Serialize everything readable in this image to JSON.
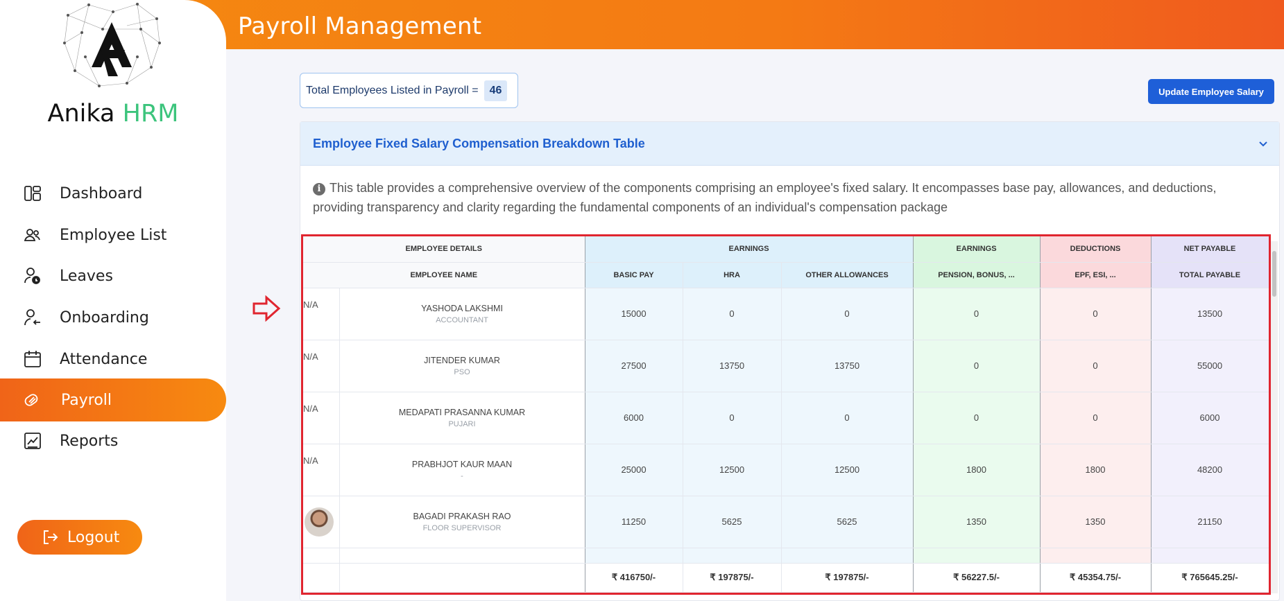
{
  "header": {
    "title": "Payroll Management"
  },
  "brand": {
    "name": "Anika",
    "suffix": "HRM"
  },
  "sidebar": {
    "items": [
      {
        "label": "Dashboard",
        "icon": "dashboard-icon",
        "active": false
      },
      {
        "label": "Employee List",
        "icon": "users-icon",
        "active": false
      },
      {
        "label": "Leaves",
        "icon": "user-clock-icon",
        "active": false
      },
      {
        "label": "Onboarding",
        "icon": "user-arrow-icon",
        "active": false
      },
      {
        "label": "Attendance",
        "icon": "calendar-icon",
        "active": false
      },
      {
        "label": "Payroll",
        "icon": "payroll-icon",
        "active": true
      },
      {
        "label": "Reports",
        "icon": "report-chart-icon",
        "active": false
      }
    ],
    "logout_label": "Logout"
  },
  "summary": {
    "label": "Total Employees Listed in Payroll =",
    "count": "46"
  },
  "actions": {
    "update_salary_label": "Update Employee Salary"
  },
  "accordion": {
    "title": "Employee Fixed Salary Compensation Breakdown Table",
    "description": "This table provides a comprehensive overview of the components comprising an employee's fixed salary. It encompasses base pay, allowances, and deductions, providing transparency and clarity regarding the fundamental components of an individual's compensation package"
  },
  "table": {
    "group_headers": [
      "EMPLOYEE DETAILS",
      "EARNINGS",
      "EARNINGS",
      "DEDUCTIONS",
      "NET PAYABLE"
    ],
    "column_headers": [
      "EMPLOYEE NAME",
      "BASIC PAY",
      "HRA",
      "OTHER ALLOWANCES",
      "PENSION, BONUS, ...",
      "EPF, ESI, ...",
      "TOTAL PAYABLE"
    ],
    "rows": [
      {
        "photo": "N/A",
        "name": "YASHODA LAKSHMI",
        "role": "ACCOUNTANT",
        "basic": "15000",
        "hra": "0",
        "other": "0",
        "pension": "0",
        "epf": "0",
        "total": "13500"
      },
      {
        "photo": "N/A",
        "name": "JITENDER KUMAR",
        "role": "PSO",
        "basic": "27500",
        "hra": "13750",
        "other": "13750",
        "pension": "0",
        "epf": "0",
        "total": "55000"
      },
      {
        "photo": "N/A",
        "name": "MEDAPATI PRASANNA KUMAR",
        "role": "PUJARI",
        "basic": "6000",
        "hra": "0",
        "other": "0",
        "pension": "0",
        "epf": "0",
        "total": "6000"
      },
      {
        "photo": "N/A",
        "name": "PRABHJOT KAUR MAAN",
        "role": "-",
        "basic": "25000",
        "hra": "12500",
        "other": "12500",
        "pension": "1800",
        "epf": "1800",
        "total": "48200"
      },
      {
        "photo": "avatar",
        "name": "BAGADI PRAKASH RAO",
        "role": "FLOOR SUPERVISOR",
        "basic": "11250",
        "hra": "5625",
        "other": "5625",
        "pension": "1350",
        "epf": "1350",
        "total": "21150"
      }
    ],
    "totals": {
      "basic": "₹ 416750/-",
      "hra": "₹ 197875/-",
      "other": "₹ 197875/-",
      "pension": "₹ 56227.5/-",
      "epf": "₹ 45354.75/-",
      "total": "₹ 765645.25/-"
    }
  },
  "colors": {
    "accent": "#f58a10",
    "primary_button": "#1e5fd8",
    "highlight_border": "#e0252f"
  }
}
